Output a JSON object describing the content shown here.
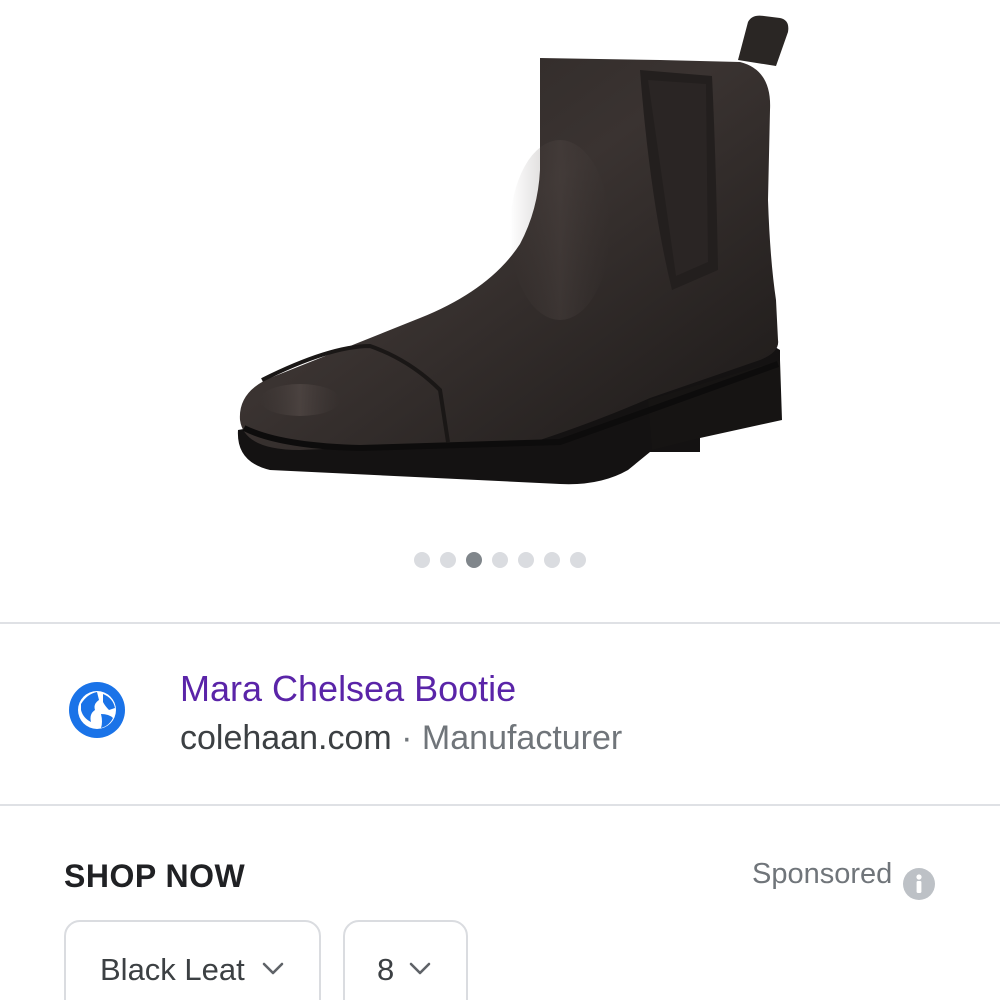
{
  "product_image": {
    "icon": "chelsea-boot-image",
    "carousel": {
      "count": 7,
      "active_index": 2
    }
  },
  "result": {
    "title": "Mara Chelsea Bootie",
    "domain": "colehaan.com",
    "separator": "·",
    "source_type": "Manufacturer",
    "icon": "globe-icon",
    "title_color": "#5a24a8"
  },
  "shop": {
    "heading": "SHOP NOW",
    "sponsored_label": "Sponsored",
    "color_select": {
      "value": "Black Leat"
    },
    "size_select": {
      "value": "8"
    }
  }
}
